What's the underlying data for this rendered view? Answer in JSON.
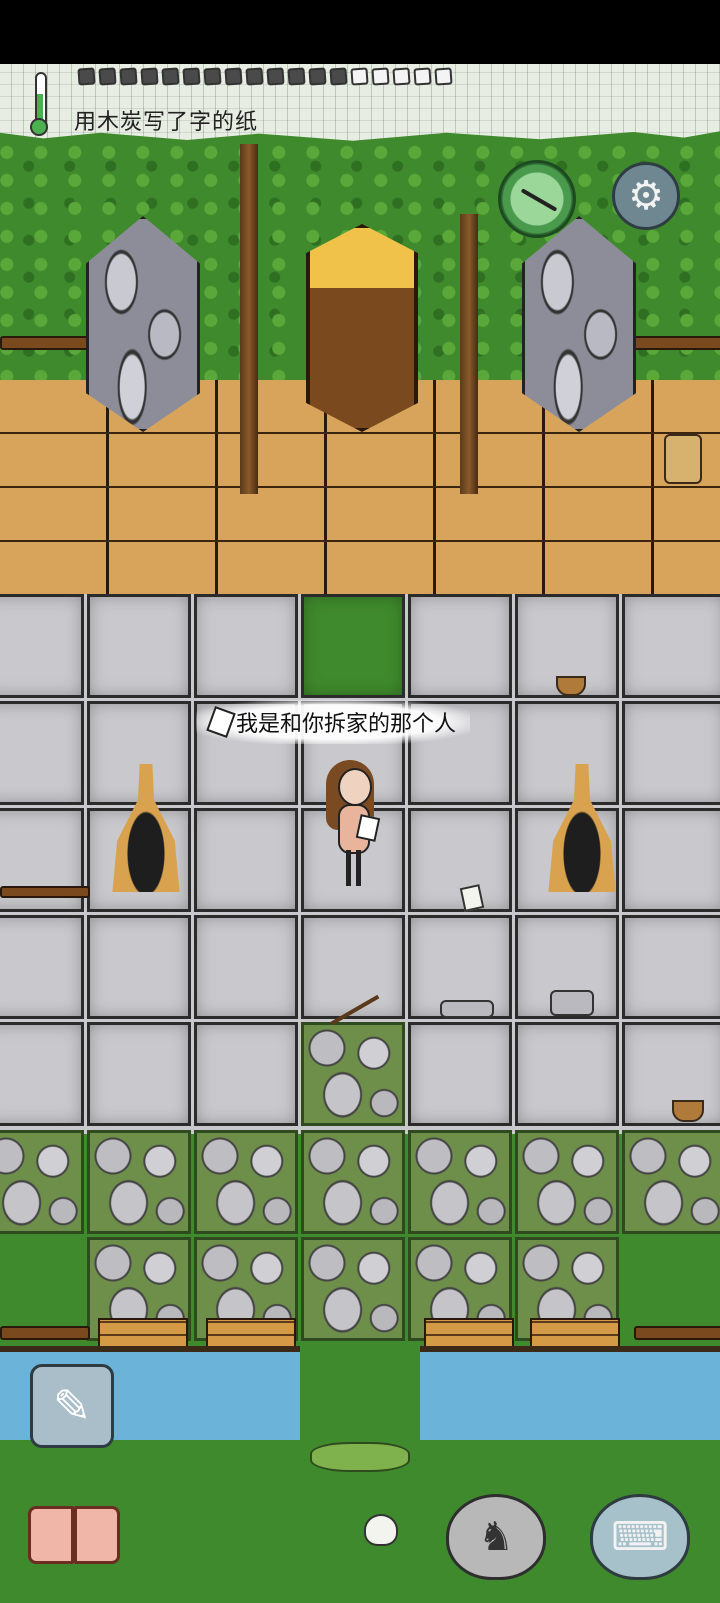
{
  "hud": {
    "item_label": "用木炭写了字的纸",
    "food_pips_filled": 13,
    "food_pips_total": 18,
    "temperature_icon": "thermometer-icon",
    "speech_text": "我是和你拆家的那个人",
    "buttons": {
      "compass": "compass-icon",
      "settings": "gear-icon",
      "settings_glyph": "⚙",
      "pencil_glyph": "✎",
      "emote_glyph": "♞",
      "keyboard_glyph": "⌨",
      "book": "book-icon"
    }
  },
  "colors": {
    "grass": "#3f8a2c",
    "floor_wood": "#d8a35a",
    "stone_tile": "#c9c9cd",
    "water": "#6bb3d8",
    "thermometer": "#4caf50"
  }
}
